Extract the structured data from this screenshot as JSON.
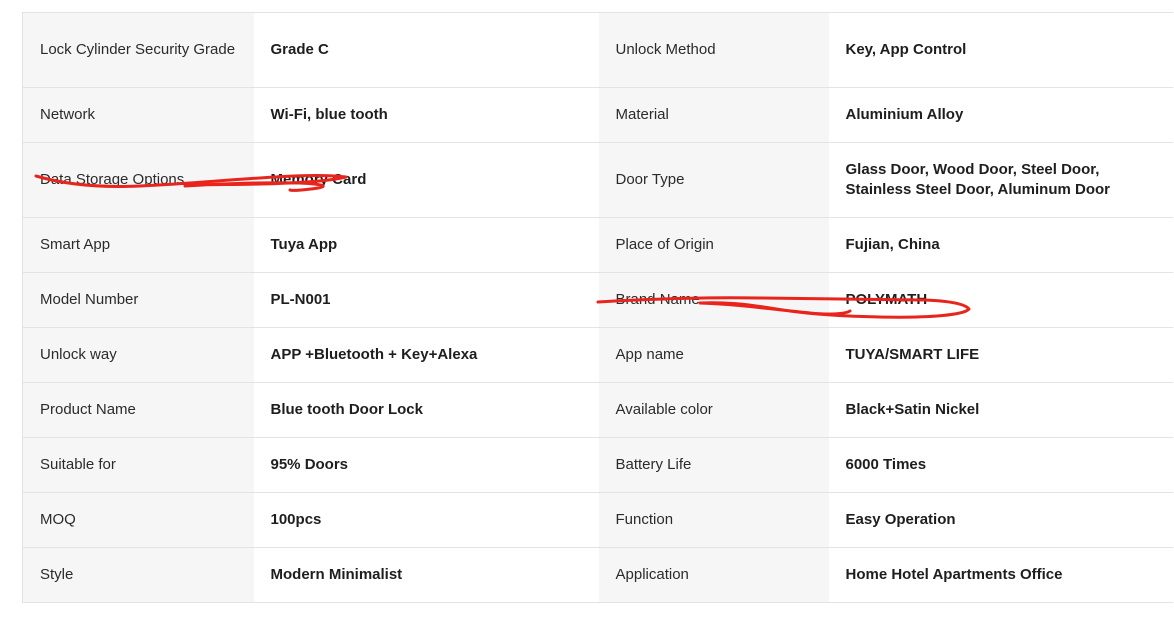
{
  "spec_table": {
    "rows": [
      {
        "label1": "Lock Cylinder Security Grade",
        "value1": "Grade C",
        "label2": "Unlock Method",
        "value2": "Key, App Control"
      },
      {
        "label1": "Network",
        "value1": "Wi-Fi, blue tooth",
        "label2": "Material",
        "value2": "Aluminium Alloy"
      },
      {
        "label1": "Data Storage Options",
        "value1": "Memory Card",
        "label2": "Door Type",
        "value2": "Glass Door, Wood Door, Steel Door, Stainless Steel Door, Aluminum Door"
      },
      {
        "label1": "Smart App",
        "value1": "Tuya App",
        "label2": "Place of Origin",
        "value2": "Fujian, China"
      },
      {
        "label1": "Model Number",
        "value1": "PL-N001",
        "label2": "Brand Name",
        "value2": "POLYMATH"
      },
      {
        "label1": "Unlock way",
        "value1": "APP +Bluetooth + Key+Alexa",
        "label2": "App name",
        "value2": "TUYA/SMART LIFE"
      },
      {
        "label1": "Product Name",
        "value1": "Blue tooth Door Lock",
        "label2": "Available color",
        "value2": "Black+Satin Nickel"
      },
      {
        "label1": "Suitable for",
        "value1": "95% Doors",
        "label2": "Battery Life",
        "value2": "6000 Times"
      },
      {
        "label1": "MOQ",
        "value1": "100pcs",
        "label2": "Function",
        "value2": "Easy Operation"
      },
      {
        "label1": "Style",
        "value1": "Modern Minimalist",
        "label2": "Application",
        "value2": "Home Hotel Apartments Office"
      }
    ]
  },
  "annotations": {
    "scribble_color": "#e8241c"
  }
}
